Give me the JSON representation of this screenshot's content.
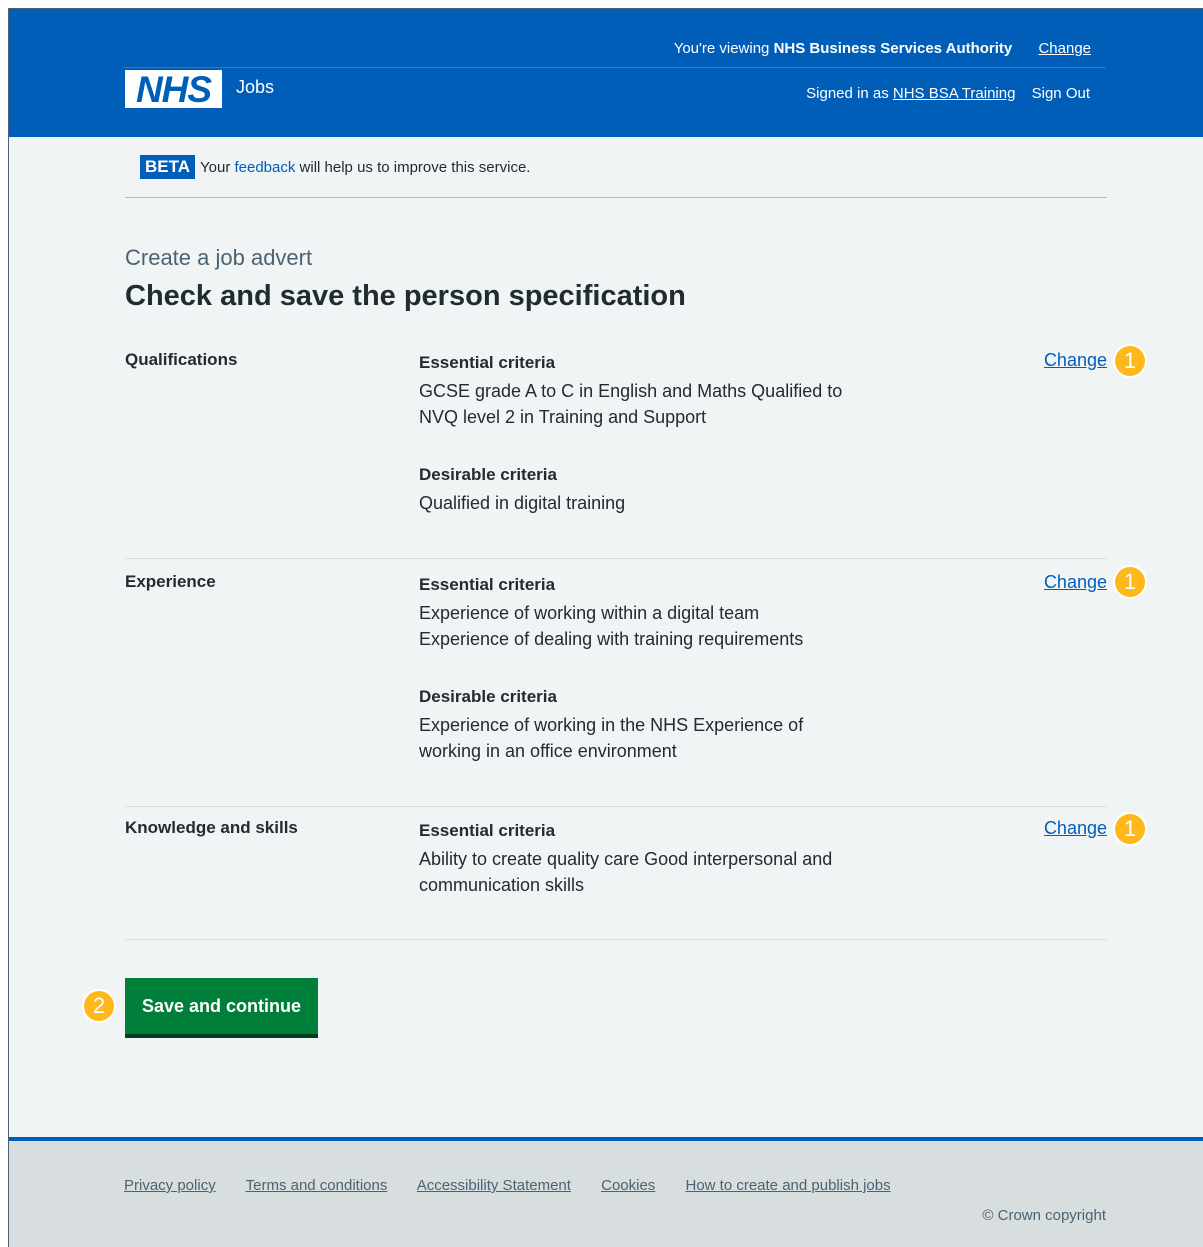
{
  "header": {
    "viewing_prefix": "You're viewing",
    "viewing_org": "NHS Business Services Authority",
    "change_org_label": "Change",
    "signed_prefix": "Signed in as",
    "signed_user": "NHS BSA Training",
    "sign_out_label": "Sign Out",
    "logo_text": "NHS",
    "service_name": "Jobs"
  },
  "beta": {
    "tag": "BETA",
    "prefix": "Your",
    "link": "feedback",
    "suffix": "will help us to improve this service."
  },
  "page": {
    "caption": "Create a job advert",
    "title": "Check and save the person specification"
  },
  "summary": {
    "qualifications": {
      "key": "Qualifications",
      "essential_title": "Essential criteria",
      "essential_text": "GCSE grade A to C in English and Maths Qualified to NVQ level 2 in Training and Support",
      "desirable_title": "Desirable criteria",
      "desirable_text": "Qualified in digital training",
      "change_label": "Change"
    },
    "experience": {
      "key": "Experience",
      "essential_title": "Essential criteria",
      "essential_line1": "Experience of working within a digital team",
      "essential_line2": "Experience of dealing with training requirements",
      "desirable_title": "Desirable criteria",
      "desirable_text": "Experience of working in the NHS Experience of working in an office environment",
      "change_label": "Change"
    },
    "knowledge": {
      "key": "Knowledge and skills",
      "essential_title": "Essential criteria",
      "essential_text": "Ability to create quality care Good interpersonal and communication skills",
      "change_label": "Change"
    }
  },
  "badges": {
    "change": "1",
    "save": "2"
  },
  "button": {
    "save_label": "Save and continue"
  },
  "footer": {
    "links": [
      "Privacy policy",
      "Terms and conditions",
      "Accessibility Statement",
      "Cookies",
      "How to create and publish jobs"
    ],
    "copyright": "© Crown copyright"
  },
  "colors": {
    "header_blue": "#005eb8",
    "button_green": "#007f3b",
    "badge_yellow": "#ffb81c"
  }
}
